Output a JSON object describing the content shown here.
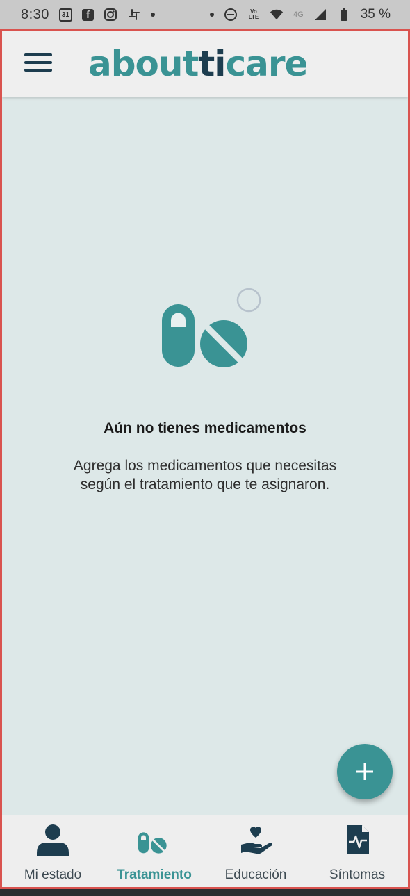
{
  "status_bar": {
    "time": "8:30",
    "calendar_day": "31",
    "battery": "35 %",
    "network": "4G",
    "volte": "Vo LTE"
  },
  "header": {
    "logo_part1": "about",
    "logo_part2": "ti",
    "logo_part3": " care",
    "menu_icon": "hamburger-icon"
  },
  "empty_state": {
    "icon": "pills-icon",
    "title": "Aún no tienes medicamentos",
    "description": "Agrega los medicamentos que necesitas según el tratamiento que te asignaron."
  },
  "fab": {
    "icon": "plus-icon"
  },
  "bottom_nav": {
    "items": [
      {
        "label": "Mi estado",
        "icon": "person-icon",
        "active": false
      },
      {
        "label": "Tratamiento",
        "icon": "pills-icon",
        "active": true
      },
      {
        "label": "Educación",
        "icon": "heart-hand-icon",
        "active": false
      },
      {
        "label": "Síntomas",
        "icon": "document-pulse-icon",
        "active": false
      }
    ]
  },
  "colors": {
    "brand_teal": "#3a9394",
    "brand_navy": "#1d3d4f",
    "background": "#dde8e8"
  }
}
